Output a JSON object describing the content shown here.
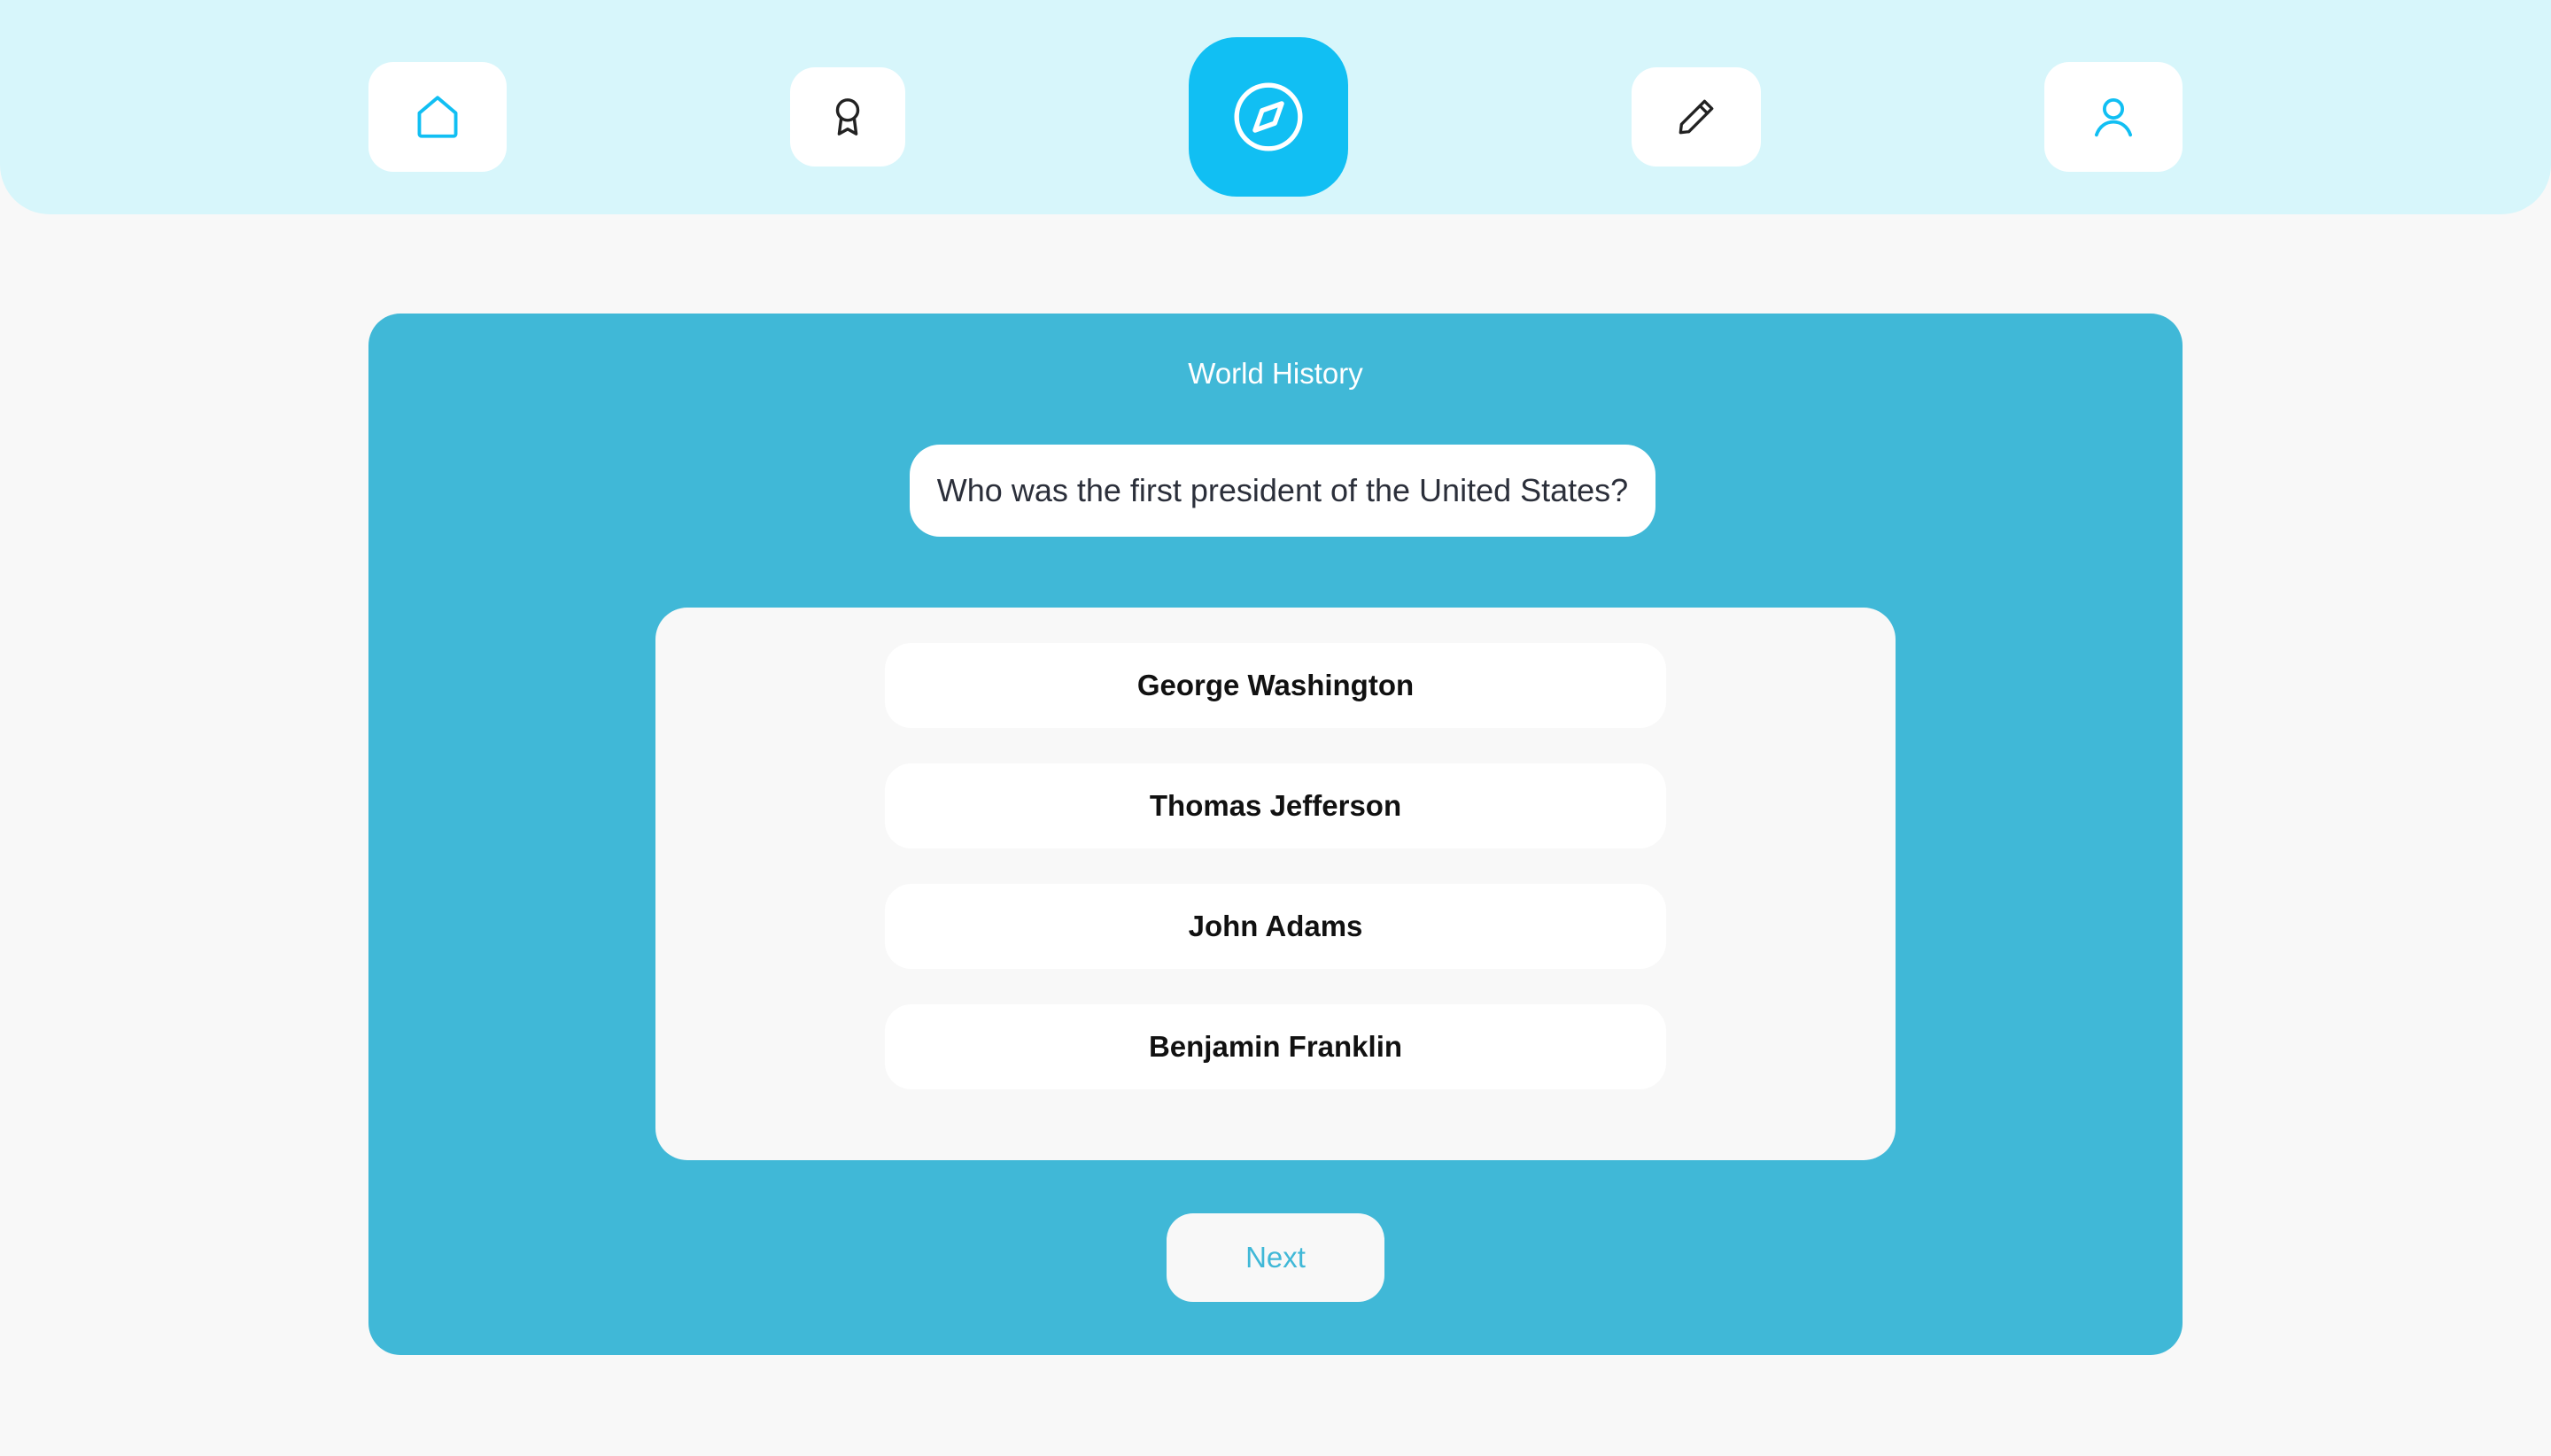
{
  "colors": {
    "nav_background": "#d7f6fb",
    "active_nav": "#11bff3",
    "card_background": "#40b8d7",
    "page_background": "#f8f8f8",
    "accent_icon": "#11bff3",
    "dark_icon": "#222222",
    "next_text": "#40b8d7"
  },
  "nav": {
    "items": [
      {
        "icon": "home-icon",
        "active": false
      },
      {
        "icon": "award-icon",
        "active": false
      },
      {
        "icon": "compass-icon",
        "active": true
      },
      {
        "icon": "pencil-icon",
        "active": false
      },
      {
        "icon": "user-icon",
        "active": false
      }
    ]
  },
  "quiz": {
    "category": "World History",
    "question": "Who was the first president of the United States?",
    "answers": [
      "George Washington",
      "Thomas Jefferson",
      "John Adams",
      "Benjamin Franklin"
    ],
    "next_label": "Next"
  }
}
